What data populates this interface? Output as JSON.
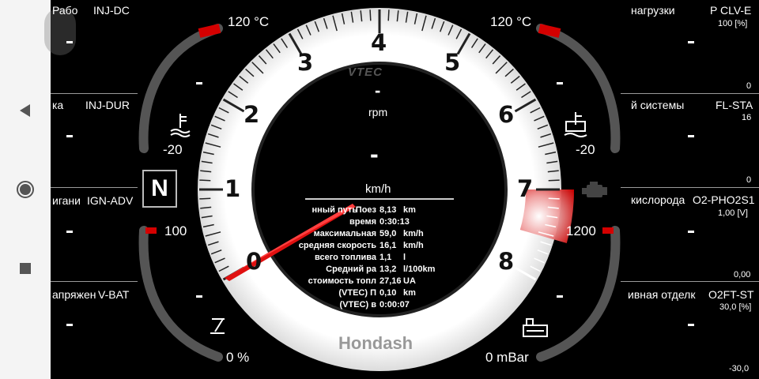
{
  "colors": {
    "redline": "#d40000",
    "accent_red": "#e01010",
    "dial_white": "#f5f5f5"
  },
  "gear": "N",
  "tach": {
    "brand": "VTEC",
    "rpm_value": "-",
    "rpm_label": "rpm",
    "speed_value": "-",
    "speed_unit": "km/h",
    "numbers": [
      "0",
      "1",
      "2",
      "3",
      "4",
      "5",
      "6",
      "7",
      "8"
    ],
    "logo": "Hondash"
  },
  "gauges": {
    "left_top_max": "120 °C",
    "left_top_min": "-20",
    "right_top_max": "120 °C",
    "right_top_min": "-20",
    "left_bottom_max": "100",
    "left_bottom_min": "0 %",
    "right_bottom_max": "1200",
    "right_bottom_min": "0 mBar"
  },
  "stats": [
    {
      "label": "нный путь",
      "extra": "Поез",
      "value": "8,13",
      "unit": "km"
    },
    {
      "label": "время",
      "extra": "",
      "value": "0:30:13",
      "unit": ""
    },
    {
      "label": "максимальная",
      "extra": "",
      "value": "59,0",
      "unit": "km/h"
    },
    {
      "label": "средняя скорость",
      "extra": "",
      "value": "16,1",
      "unit": "km/h"
    },
    {
      "label": "всего топлива",
      "extra": "",
      "value": "1,1",
      "unit": "l"
    },
    {
      "label": "Средний ра",
      "extra": "",
      "value": "13,2",
      "unit": "l/100km"
    },
    {
      "label": "стоимость топл",
      "extra": "",
      "value": "27,16",
      "unit": "UA"
    },
    {
      "label": "(VTEC) П",
      "extra": "",
      "value": "0,10",
      "unit": "km"
    },
    {
      "label": "(VTEC) в",
      "extra": "",
      "value": "0:00:07",
      "unit": ""
    }
  ],
  "left_panels": [
    {
      "name": "Рабо",
      "code": "INJ-DC",
      "value": "-"
    },
    {
      "name": "ка",
      "code": "INJ-DUR",
      "value": "-"
    },
    {
      "name": "игани",
      "code": "IGN-ADV",
      "value": "-"
    },
    {
      "name": "апряжен",
      "code": "V-BAT",
      "value": "-"
    }
  ],
  "right_panels": [
    {
      "name": "нагрузки",
      "code": "P CLV-E",
      "unit": "100 [%]",
      "value": "-",
      "min": "0"
    },
    {
      "name": "й системы",
      "code": "FL-STA",
      "unit": "16",
      "value": "-",
      "min": "0"
    },
    {
      "name": "кислорода",
      "code": "O2-PHO2S1",
      "unit": "1,00 [V]",
      "value": "-",
      "min": "0,00"
    },
    {
      "name": "ивная отделк",
      "code": "O2FT-ST",
      "unit": "30,0 [%]",
      "value": "-",
      "min": "-30,0"
    }
  ]
}
